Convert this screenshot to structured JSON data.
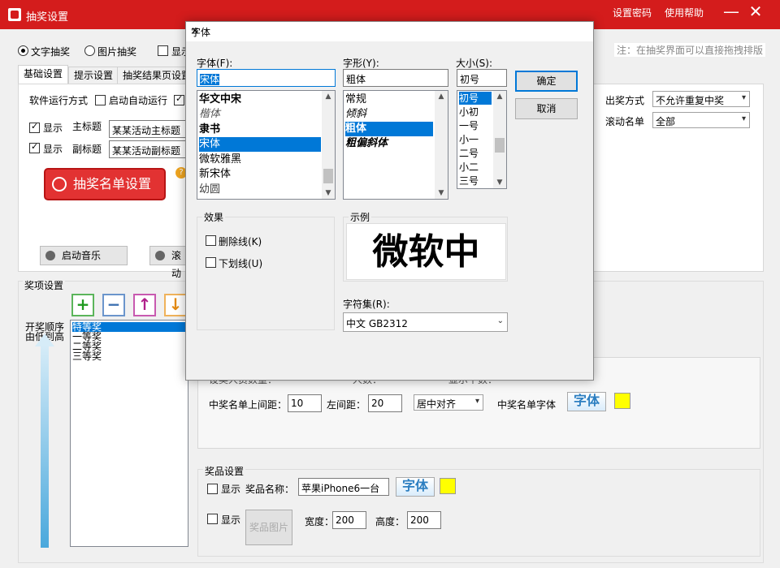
{
  "window": {
    "title": "抽奖设置",
    "links": [
      "设置密码",
      "使用帮助"
    ],
    "minimize": "—",
    "close": "✕"
  },
  "mode": {
    "options": [
      "文字抽奖",
      "图片抽奖",
      "显示"
    ],
    "selected": "文字抽奖",
    "hint": "注：在抽奖界面可以直接拖拽排版"
  },
  "tabs": [
    "基础设置",
    "提示设置",
    "抽奖结果页设置"
  ],
  "basic": {
    "run_mode_label": "软件运行方式",
    "auto_start_label": "启动自动运行",
    "show_label": "显示",
    "main_title_label": "主标题",
    "main_title_value": "某某活动主标题",
    "sub_title_label": "副标题",
    "sub_title_value": "某某活动副标题",
    "list_button": "抽奖名单设置",
    "help": "?",
    "music_button": "启动音乐",
    "scroll_button": "滚动"
  },
  "right_settings": {
    "draw_mode_label": "出奖方式",
    "draw_mode_value": "不允许重复中奖",
    "scroll_list_label": "滚动名单",
    "scroll_list_value": "全部"
  },
  "prize": {
    "section_label": "奖项设置",
    "order_label_1": "开奖顺序",
    "order_label_2": "由低到高",
    "tools": {
      "add": "+",
      "remove": "−",
      "up": "↑",
      "down": "↓"
    },
    "items": [
      "特等奖",
      "一等奖",
      "二等奖",
      "三等奖"
    ],
    "selected_index": 0
  },
  "winner": {
    "partial_labels": [
      "设奖人员数量：",
      "人数：",
      "显示个数："
    ],
    "top_margin_label": "中奖名单上间距：",
    "top_margin_value": "10",
    "left_margin_label": "左间距：",
    "left_margin_value": "20",
    "align_value": "居中对齐",
    "font_label": "中奖名单字体",
    "font_button": "字体",
    "font_color": "#ffff00"
  },
  "goods": {
    "section_label": "奖品设置",
    "show_label": "显示",
    "name_label": "奖品名称：",
    "name_value": "苹果iPhone6一台",
    "font_button": "字体",
    "font_color": "#ffff00",
    "image_button": "奖品图片",
    "width_label": "宽度：",
    "width_value": "200",
    "height_label": "高度：",
    "height_value": "200"
  },
  "font_dialog": {
    "title": "字体",
    "close": "✕",
    "family_label": "字体(F):",
    "family_value": "宋体",
    "families": [
      "华文中宋",
      "楷体",
      "隶书",
      "宋体",
      "微软雅黑",
      "新宋体",
      "幼圆"
    ],
    "family_selected": 3,
    "style_label": "字形(Y):",
    "style_value": "粗体",
    "styles": [
      "常规",
      "倾斜",
      "粗体",
      "粗偏斜体"
    ],
    "style_selected": 2,
    "size_label": "大小(S):",
    "size_value": "初号",
    "sizes": [
      "初号",
      "小初",
      "一号",
      "小一",
      "二号",
      "小二",
      "三号"
    ],
    "size_selected": 0,
    "ok": "确定",
    "cancel": "取消",
    "effects_label": "效果",
    "strikeout": "删除线(K)",
    "underline": "下划线(U)",
    "sample_label": "示例",
    "sample_text": "微软中",
    "charset_label": "字符集(R):",
    "charset_value": "中文 GB2312"
  }
}
